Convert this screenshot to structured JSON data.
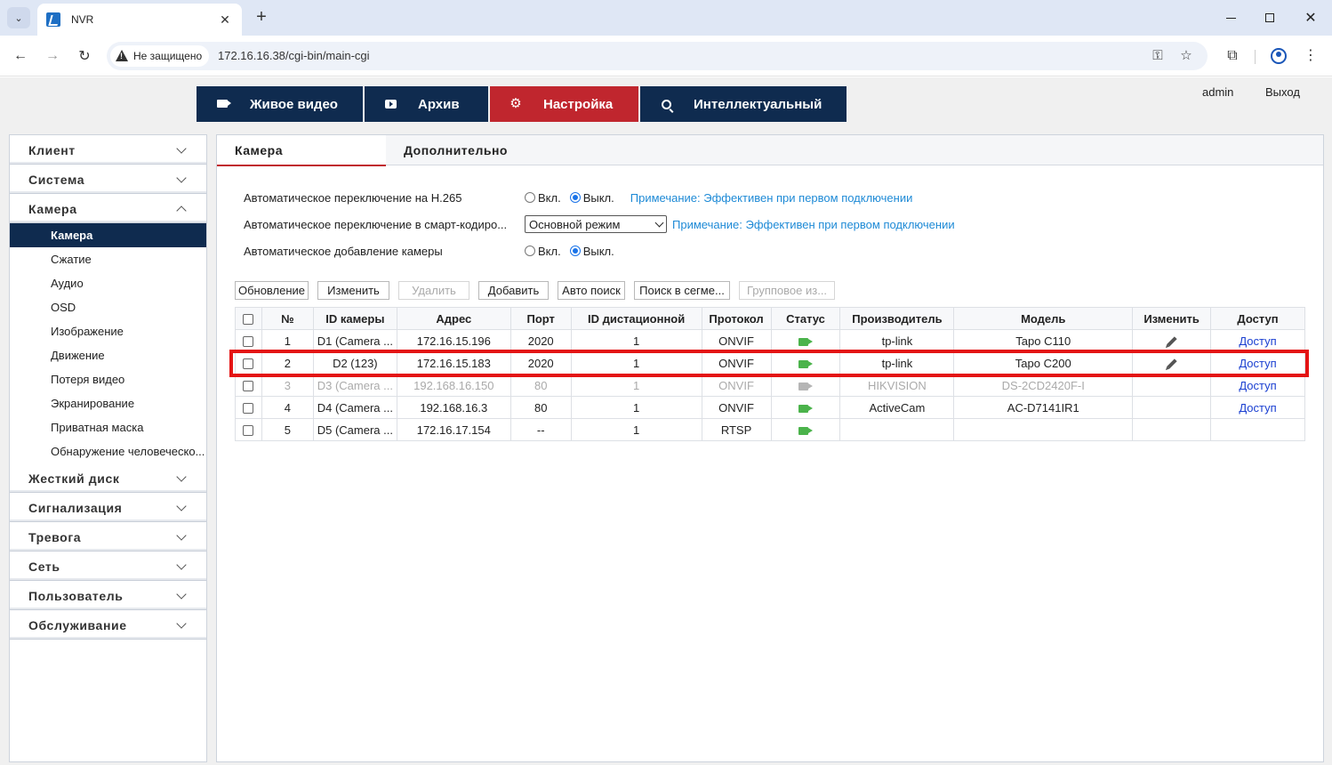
{
  "browser": {
    "tab_title": "NVR",
    "security_label": "Не защищено",
    "url": "172.16.16.38/cgi-bin/main-cgi"
  },
  "topnav": {
    "items": [
      {
        "label": "Живое видео",
        "icon": "camera-icon"
      },
      {
        "label": "Архив",
        "icon": "play-icon"
      },
      {
        "label": "Настройка",
        "icon": "gear-icon",
        "active": true
      },
      {
        "label": "Интеллектуальный",
        "icon": "search-icon"
      }
    ],
    "user": "admin",
    "logout": "Выход"
  },
  "sidebar": {
    "groups_top": [
      "Клиент",
      "Система"
    ],
    "camera_group": "Камера",
    "camera_items": [
      "Камера",
      "Сжатие",
      "Аудио",
      "OSD",
      "Изображение",
      "Движение",
      "Потеря видео",
      "Экранирование",
      "Приватная маска",
      "Обнаружение человеческо..."
    ],
    "groups_bottom": [
      "Жесткий диск",
      "Сигнализация",
      "Тревога",
      "Сеть",
      "Пользователь",
      "Обслуживание"
    ]
  },
  "content": {
    "tabs": [
      "Камера",
      "Дополнительно"
    ],
    "settings": {
      "h265_label": "Автоматическое переключение на H.265",
      "smart_label": "Автоматическое переключение в смарт-кодиро...",
      "autoadd_label": "Автоматическое добавление камеры",
      "on": "Вкл.",
      "off": "Выкл.",
      "note": "Примечание: Эффективен при первом подключении",
      "smart_select": "Основной режим"
    },
    "buttons": {
      "refresh": "Обновление",
      "edit": "Изменить",
      "delete": "Удалить",
      "add": "Добавить",
      "auto_search": "Авто поиск",
      "segment_search": "Поиск в сегме...",
      "batch": "Групповое из..."
    },
    "table": {
      "headers": [
        "№",
        "ID камеры",
        "Адрес",
        "Порт",
        "ID дистационной",
        "Протокол",
        "Статус",
        "Производитель",
        "Модель",
        "Изменить",
        "Доступ"
      ],
      "rows": [
        {
          "no": "1",
          "id": "D1 (Camera ...",
          "addr": "172.16.15.196",
          "port": "2020",
          "remote": "1",
          "proto": "ONVIF",
          "vendor": "tp-link",
          "model": "Tapo C110",
          "access": "Доступ"
        },
        {
          "no": "2",
          "id": "D2 (123)",
          "addr": "172.16.15.183",
          "port": "2020",
          "remote": "1",
          "proto": "ONVIF",
          "vendor": "tp-link",
          "model": "Tapo C200",
          "access": "Доступ"
        },
        {
          "no": "3",
          "id": "D3 (Camera ...",
          "addr": "192.168.16.150",
          "port": "80",
          "remote": "1",
          "proto": "ONVIF",
          "vendor": "HIKVISION",
          "model": "DS-2CD2420F-I",
          "access": "Доступ"
        },
        {
          "no": "4",
          "id": "D4 (Camera ...",
          "addr": "192.168.16.3",
          "port": "80",
          "remote": "1",
          "proto": "ONVIF",
          "vendor": "ActiveCam",
          "model": "AC-D7141IR1",
          "access": "Доступ"
        },
        {
          "no": "5",
          "id": "D5 (Camera ...",
          "addr": "172.16.17.154",
          "port": "--",
          "remote": "1",
          "proto": "RTSP",
          "vendor": "",
          "model": "",
          "access": ""
        }
      ]
    }
  },
  "colors": {
    "nav_bg": "#0f2b4f",
    "nav_active": "#c0262e",
    "note": "#1e8ad6",
    "highlight": "#e41414",
    "status_online": "#4bb34b"
  }
}
